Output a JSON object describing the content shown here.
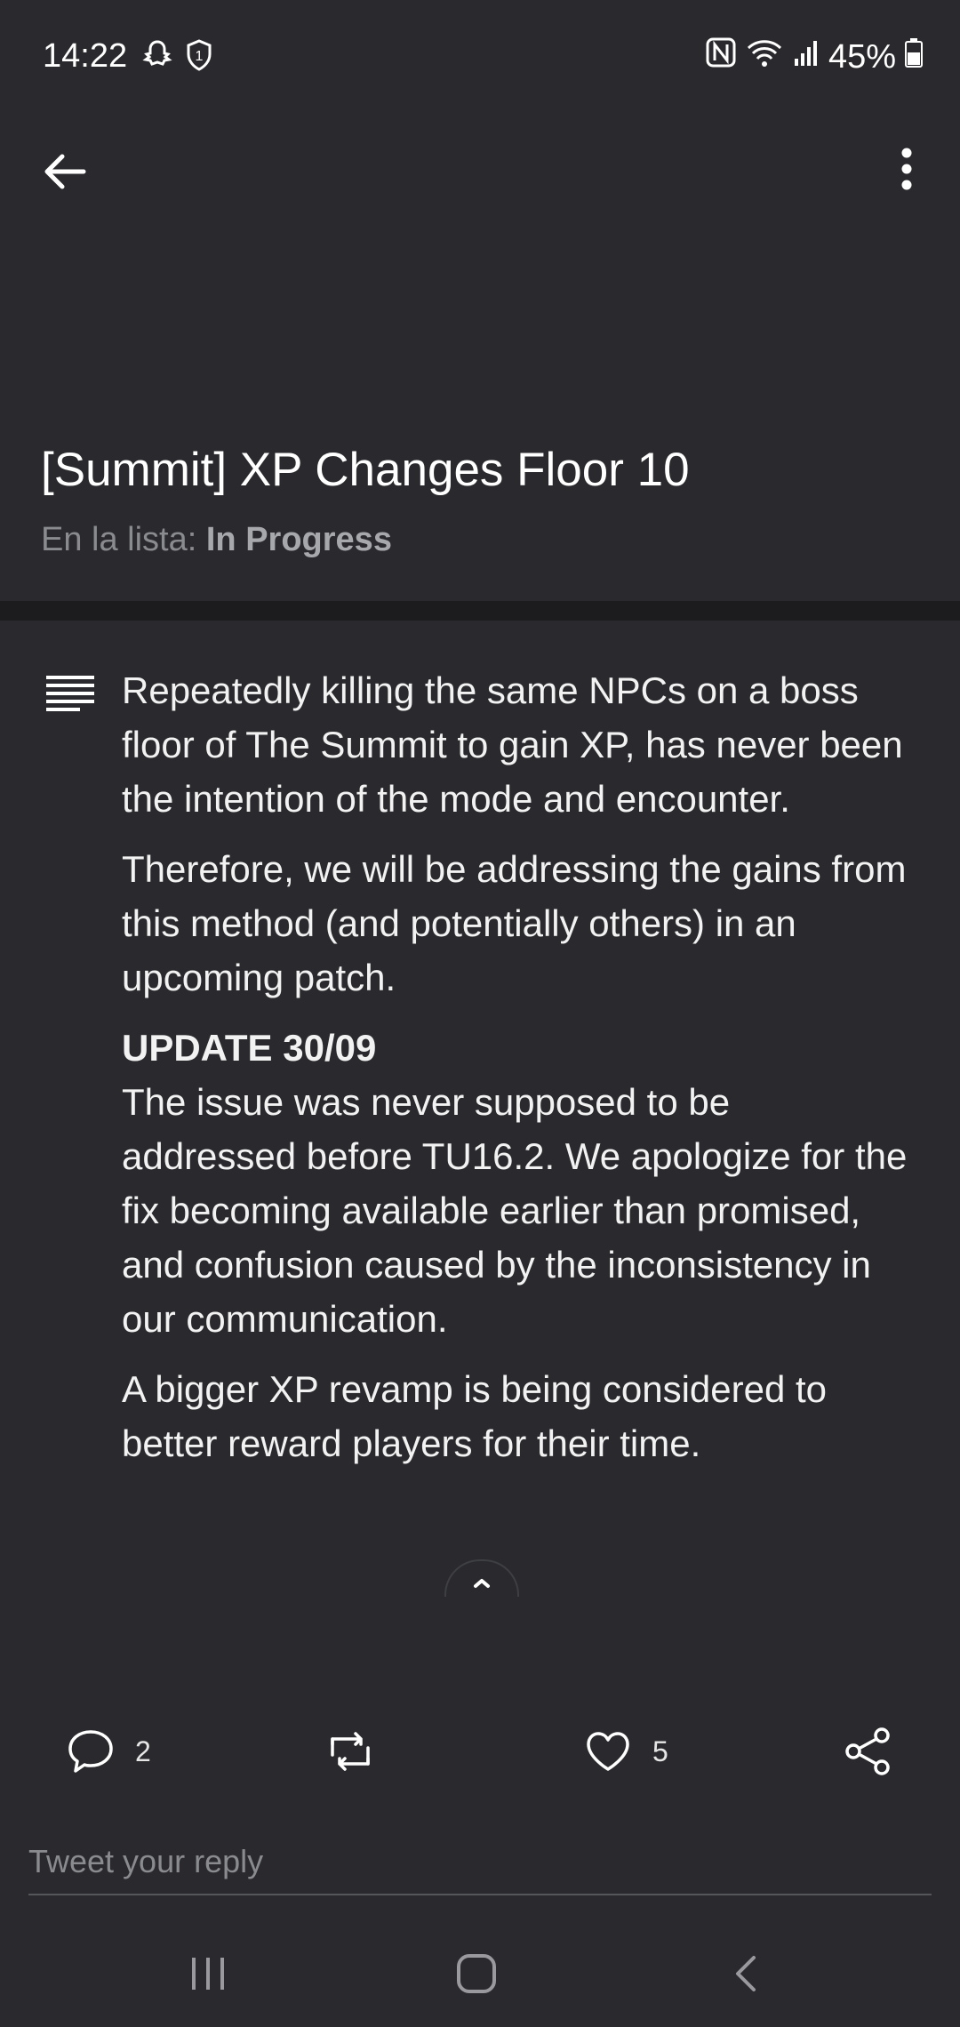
{
  "status": {
    "time": "14:22",
    "battery": "45%",
    "icons": [
      "snapchat-icon",
      "shield-1-icon",
      "nfc-icon",
      "wifi-icon",
      "signal-icon",
      "battery-icon"
    ]
  },
  "header": {
    "title": "[Summit] XP Changes Floor 10",
    "list_prefix": "En la lista: ",
    "list_name": "In Progress"
  },
  "content": {
    "para1": "Repeatedly killing the same NPCs on a boss floor of The Summit to gain XP, has never been the intention of the mode and encounter.",
    "para2": "Therefore, we will be addressing the gains from this method (and potentially others) in an upcoming patch.",
    "update_heading": "UPDATE 30/09",
    "para3": "The issue was never supposed to be addressed before TU16.2. We apologize for the fix becoming available earlier than promised, and confusion caused by the inconsistency in our communication.",
    "para4": "A bigger XP revamp is being considered to better reward players for their time."
  },
  "actions": {
    "comments": "2",
    "likes": "5"
  },
  "reply": {
    "placeholder": "Tweet your reply"
  },
  "colors": {
    "background": "#2a2a2e",
    "divider": "#1c1c1f",
    "muted_text": "#8a8b8f"
  }
}
